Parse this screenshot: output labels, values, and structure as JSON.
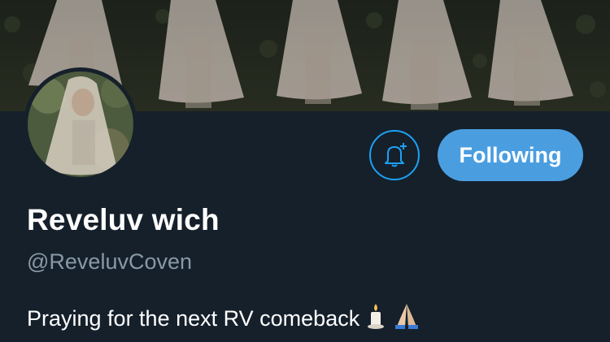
{
  "profile": {
    "display_name": "Reveluv wich",
    "handle": "@ReveluvCoven",
    "bio": "Praying for the next RV comeback",
    "bio_emojis": [
      "candle-emoji",
      "folded-hands-emoji"
    ]
  },
  "actions": {
    "notify_icon": "bell-plus-icon",
    "follow_label": "Following"
  },
  "colors": {
    "background": "#15202b",
    "accent": "#1da1f2",
    "follow_button": "#4a9ee0",
    "handle_text": "#8899a6"
  }
}
